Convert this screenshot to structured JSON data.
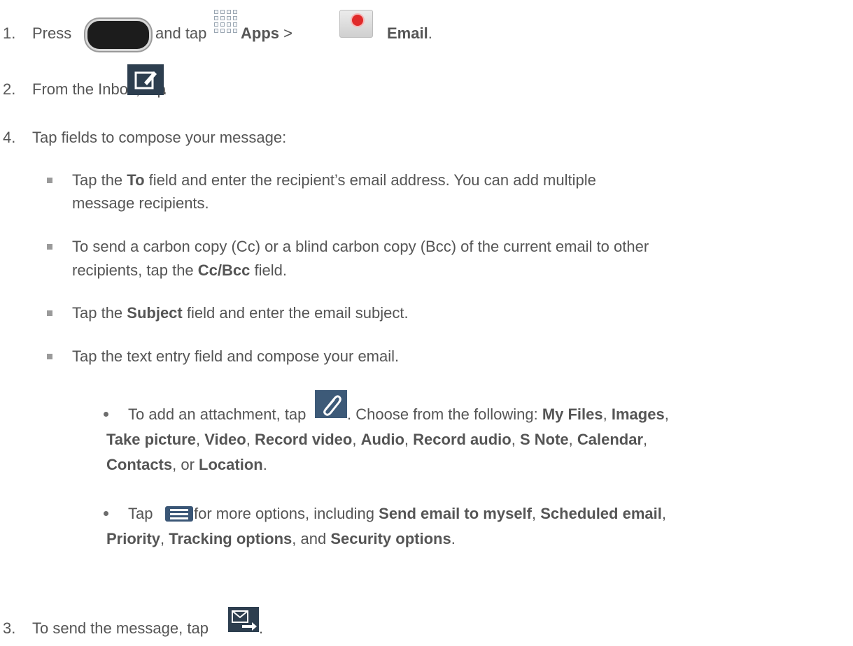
{
  "steps": {
    "s1": {
      "num": "1.",
      "press": "Press",
      "and_tap": "and tap",
      "apps": "Apps",
      "sep": ">",
      "email": "Email",
      "period": "."
    },
    "s2": {
      "num": "2.",
      "text": "From the Inbox, tap",
      "period": "."
    },
    "s4": {
      "num": "4.",
      "text": "Tap fields to compose your message:"
    },
    "s3": {
      "num": "3.",
      "text": "To send the message, tap",
      "period": "."
    }
  },
  "bullets": {
    "to": {
      "a": "Tap the ",
      "b": "To",
      "c": " field and enter the recipient’s email address. You can add multiple",
      "d": "message recipients."
    },
    "cc": {
      "a": "To send a carbon copy (Cc) or a blind carbon copy (Bcc) of the current email to other",
      "b": "recipients, tap the ",
      "c": "Cc/Bcc",
      "d": " field."
    },
    "subject": {
      "a": "Tap the ",
      "b": "Subject",
      "c": " field and enter the email subject."
    },
    "text_entry": {
      "a": "Tap the text entry field and compose your email."
    }
  },
  "subbullets": {
    "attach": {
      "a": "To add an attachment, tap",
      "b": ". Choose from the following: ",
      "my_files": "My Files",
      "comma1": ", ",
      "images": "Images",
      "comma2": ",",
      "take_picture": "Take picture",
      "c3": ", ",
      "video": "Video",
      "c4": ", ",
      "record_video": "Record video",
      "c5": ", ",
      "audio": "Audio",
      "c6": ", ",
      "record_audio": "Record audio",
      "c7": ", ",
      "s_note": "S Note",
      "c8": ", ",
      "calendar": "Calendar",
      "c9": ",",
      "contacts": "Contacts",
      "or": ", or ",
      "location": "Location",
      "end": "."
    },
    "menu": {
      "a": "Tap",
      "b": " for more options, including ",
      "send_myself": "Send email to myself",
      "c1": ", ",
      "scheduled": "Scheduled email",
      "c2": ",",
      "priority": "Priority",
      "c3": ", ",
      "tracking": "Tracking options",
      "c4": ", and ",
      "security": "Security options",
      "end": "."
    }
  },
  "icons": {
    "home_key": "home-key-icon",
    "apps": "apps-grid-icon",
    "email": "email-app-icon",
    "compose": "compose-icon",
    "attach": "paperclip-icon",
    "menu": "menu-icon",
    "send": "send-icon"
  },
  "colors": {
    "text": "#555555",
    "icon_dark_blue": "#2d3e4f",
    "email_seal_red": "#e02a2a"
  }
}
